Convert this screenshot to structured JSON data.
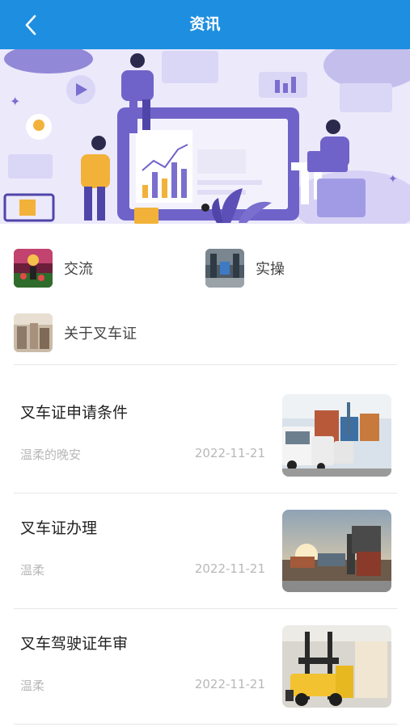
{
  "header": {
    "title": "资讯",
    "back_icon": "chevron-left-icon",
    "background": "#1E8FE0"
  },
  "banner": {
    "description_icon": "business-analytics-illustration",
    "active_slide": 1,
    "slide_count": 1
  },
  "categories": [
    {
      "label": "交流",
      "icon": "exchange-thumbnail"
    },
    {
      "label": "实操",
      "icon": "practice-thumbnail"
    },
    {
      "label": "关于叉车证",
      "icon": "about-forklift-thumbnail"
    }
  ],
  "articles": [
    {
      "title": "叉车证申请条件",
      "author": "温柔的晚安",
      "date": "2022-11-21",
      "image": "trucks-port-photo"
    },
    {
      "title": "叉车证办理",
      "author": "温柔",
      "date": "2022-11-21",
      "image": "container-yard-photo"
    },
    {
      "title": "叉车驾驶证年审",
      "author": "温柔",
      "date": "2022-11-21",
      "image": "forklift-warehouse-photo"
    }
  ]
}
